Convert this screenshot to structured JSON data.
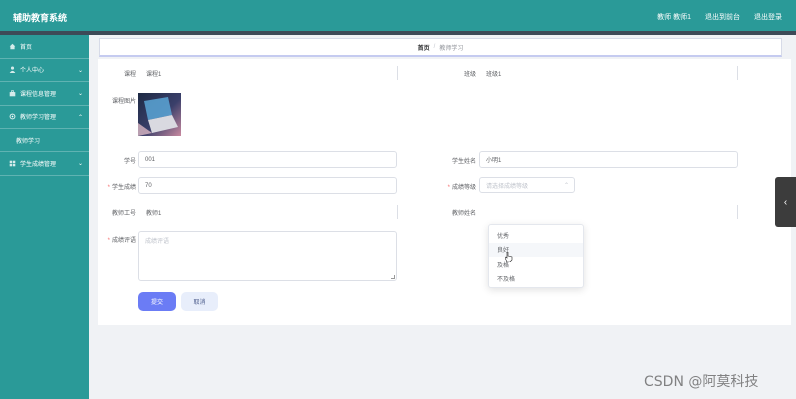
{
  "app": {
    "title": "辅助教育系统",
    "top_links": [
      "教师 教师1",
      "退出到前台",
      "退出登录"
    ]
  },
  "sidebar": {
    "items": [
      {
        "label": "首页",
        "icon": "home-icon"
      },
      {
        "label": "个人中心",
        "icon": "user-icon"
      },
      {
        "label": "课程信息管理",
        "icon": "briefcase-icon"
      },
      {
        "label": "教师学习管理",
        "icon": "settings-icon"
      },
      {
        "label": "学生成绩管理",
        "icon": "grid-icon"
      }
    ],
    "sub_item": "教师学习"
  },
  "breadcrumb": {
    "home": "首页",
    "separator": "/",
    "current": "教师学习"
  },
  "form": {
    "course": {
      "label": "课程",
      "value": "课程1"
    },
    "class": {
      "label": "班级",
      "value": "班级1"
    },
    "course_image": {
      "label": "课程图片"
    },
    "student_no": {
      "label": "学号",
      "value": "001"
    },
    "student_name": {
      "label": "学生姓名",
      "value": "小明1"
    },
    "score": {
      "label": "学生成绩",
      "value": "70"
    },
    "grade_level": {
      "label": "成绩等级",
      "placeholder": "请选择成绩等级"
    },
    "teacher_no": {
      "label": "教师工号",
      "value": "教师1"
    },
    "teacher_name": {
      "label": "教师姓名"
    },
    "evaluation": {
      "label": "成绩评语",
      "placeholder": "成绩评语"
    },
    "required_mark": "*"
  },
  "dropdown": {
    "options": [
      "优秀",
      "良好",
      "及格",
      "不及格"
    ],
    "hovered_index": 1
  },
  "buttons": {
    "submit": "提交",
    "cancel": "取消"
  },
  "side_tab": {
    "icon": "chevron-left-icon",
    "glyph": "‹"
  },
  "watermark": "CSDN @阿莫科技",
  "colors": {
    "header": "#2a9a98",
    "primary_button": "#6b7cf5",
    "page_bg": "#f0f2f5"
  }
}
